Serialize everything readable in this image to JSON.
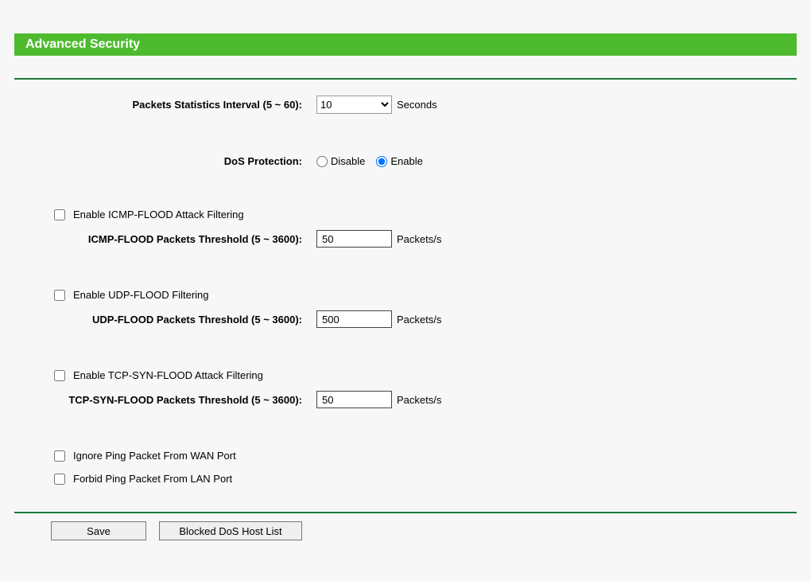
{
  "title": "Advanced Security",
  "intervalRow": {
    "label": "Packets Statistics Interval (5 ~ 60):",
    "value": "10",
    "unit": "Seconds"
  },
  "dosRow": {
    "label": "DoS Protection:",
    "disableLabel": "Disable",
    "enableLabel": "Enable",
    "selected": "enable"
  },
  "icmp": {
    "checkboxLabel": "Enable ICMP-FLOOD Attack Filtering",
    "thresholdLabel": "ICMP-FLOOD Packets Threshold (5 ~ 3600):",
    "thresholdValue": "50",
    "unit": "Packets/s"
  },
  "udp": {
    "checkboxLabel": "Enable UDP-FLOOD Filtering",
    "thresholdLabel": "UDP-FLOOD Packets Threshold (5 ~ 3600):",
    "thresholdValue": "500",
    "unit": "Packets/s"
  },
  "tcp": {
    "checkboxLabel": "Enable TCP-SYN-FLOOD Attack Filtering",
    "thresholdLabel": "TCP-SYN-FLOOD Packets Threshold (5 ~ 3600):",
    "thresholdValue": "50",
    "unit": "Packets/s"
  },
  "ping": {
    "ignoreWanLabel": "Ignore Ping Packet From WAN Port",
    "forbidLanLabel": "Forbid Ping Packet From LAN Port"
  },
  "buttons": {
    "save": "Save",
    "blocked": "Blocked DoS Host List"
  }
}
